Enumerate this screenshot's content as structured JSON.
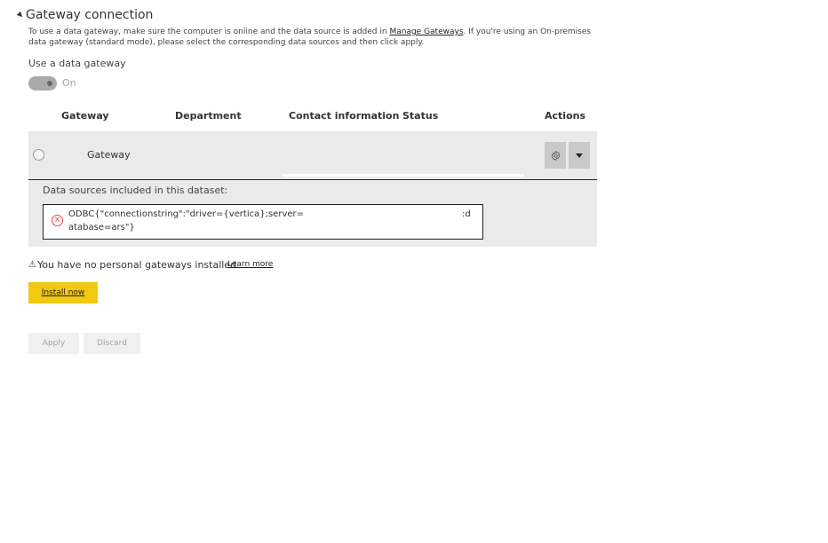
{
  "section": {
    "title": "Gateway connection",
    "description_pre": "To use a data gateway, make sure the computer is online and the data source is added in ",
    "manage_link": "Manage Gateways",
    "description_post": ". If you're using an On-premises data gateway (standard mode), please select the corresponding data sources and then click apply."
  },
  "use_gateway": {
    "label": "Use a data gateway",
    "toggle_state": "On"
  },
  "table": {
    "headers": [
      "Gateway",
      "Department",
      "Contact information",
      "Status",
      "Actions"
    ],
    "rows": [
      {
        "name": "Gateway"
      }
    ]
  },
  "data_sources": {
    "label": "Data sources included in this dataset:",
    "line1": "ODBC{\"connectionstring\":\"driver={vertica};server=",
    "line1_tail": ":d",
    "line2": "atabase=ars\"}"
  },
  "personal": {
    "warning": "You have no personal gateways installed.",
    "learn_more": "Learn more",
    "install": "Install now"
  },
  "footer": {
    "apply": "Apply",
    "discard": "Discard"
  },
  "colors": {
    "install_bg": "#f2c811",
    "row_bg": "#eaeaea",
    "error": "#e04848"
  }
}
